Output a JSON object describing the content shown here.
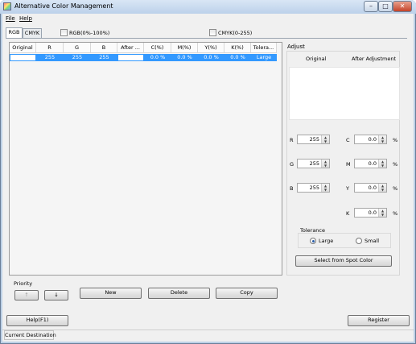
{
  "window": {
    "title": "Alternative Color Management",
    "minimize_glyph": "–",
    "maximize_glyph": "□",
    "close_glyph": "✕"
  },
  "menu": {
    "file": "File",
    "help": "Help"
  },
  "tabs": {
    "rgb": "RGB",
    "cmyk": "CMYK"
  },
  "checkboxes": {
    "rgb_percent": "RGB(0%-100%)",
    "cmyk_range": "CMYK(0-255)"
  },
  "table": {
    "headers": [
      "Original",
      "R",
      "G",
      "B",
      "After ...",
      "C(%)",
      "M(%)",
      "Y(%)",
      "K(%)",
      "Tolera..."
    ],
    "rows": [
      [
        "",
        "255",
        "255",
        "255",
        "",
        "0.0 %",
        "0.0 %",
        "0.0 %",
        "0.0 %",
        "Large"
      ]
    ]
  },
  "adjust": {
    "title": "Adjust",
    "original_label": "Original",
    "after_label": "After Adjustment",
    "r_label": "R",
    "g_label": "G",
    "b_label": "B",
    "r_value": "255",
    "g_value": "255",
    "b_value": "255",
    "c_label": "C",
    "m_label": "M",
    "y_label": "Y",
    "k_label": "K",
    "c_value": "0.0",
    "m_value": "0.0",
    "y_value": "0.0",
    "k_value": "0.0",
    "percent": "%",
    "tolerance_title": "Tolerance",
    "tolerance_large": "Large",
    "tolerance_small": "Small",
    "tolerance_selected": "Large",
    "spot_color_button": "Select from Spot Color"
  },
  "priority": {
    "label": "Priority",
    "up_glyph": "↑",
    "down_glyph": "↓"
  },
  "actions": {
    "new": "New",
    "delete": "Delete",
    "copy": "Copy"
  },
  "footer": {
    "help": "Help(F1)",
    "register": "Register"
  },
  "status": {
    "current_destination": "Current Destination"
  }
}
